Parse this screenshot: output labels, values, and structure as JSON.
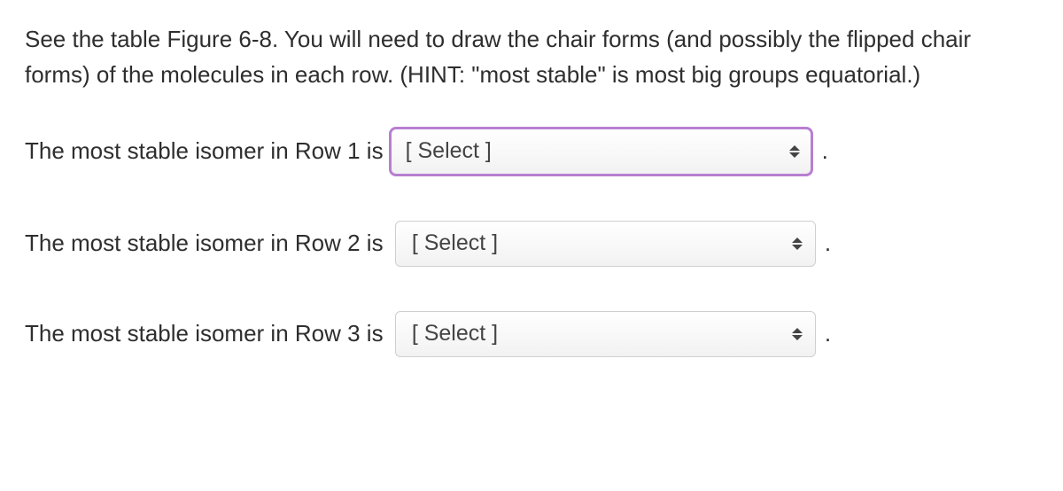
{
  "instructions": "See the table Figure 6-8. You will need to draw the chair forms (and possibly the flipped chair forms) of the molecules in each row.  (HINT: \"most stable\" is most big groups equatorial.)",
  "questions": [
    {
      "prompt": "The most stable isomer in Row 1 is",
      "selected": "[ Select ]",
      "focused": true
    },
    {
      "prompt": "The most stable isomer in Row 2 is ",
      "selected": "[ Select ]",
      "focused": false
    },
    {
      "prompt": "The most stable isomer in Row 3 is ",
      "selected": "[ Select ]",
      "focused": false
    }
  ],
  "period": "."
}
